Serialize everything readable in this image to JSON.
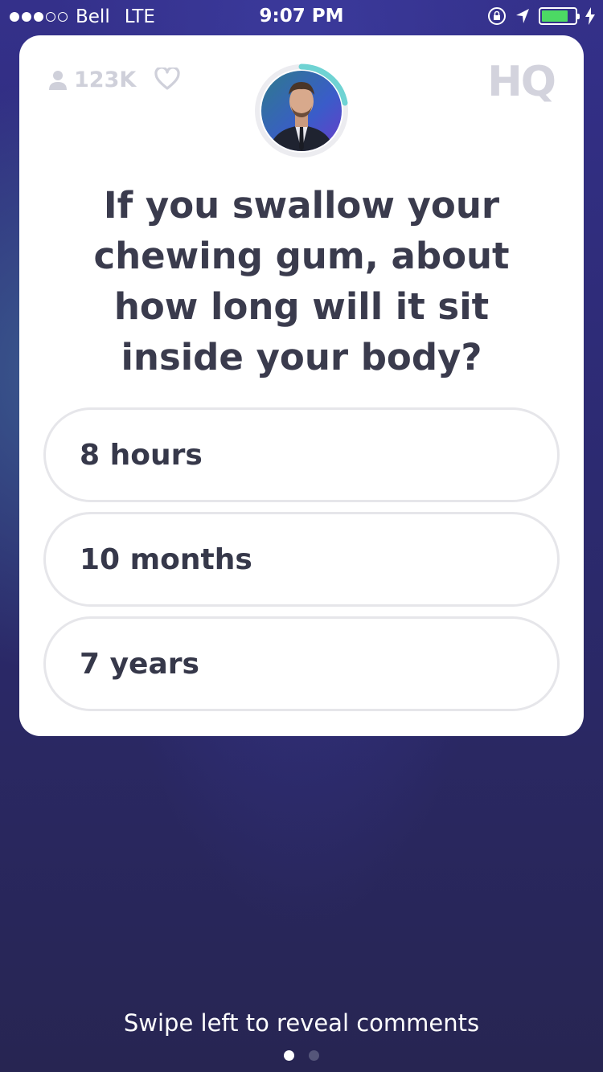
{
  "status_bar": {
    "carrier": "Bell",
    "network": "LTE",
    "time": "9:07 PM",
    "signal_bars_filled": 3,
    "signal_bars_total": 5,
    "battery_level": 0.8,
    "battery_color": "#4cd964"
  },
  "header": {
    "viewer_count": "123K",
    "logo": "HQ"
  },
  "question": {
    "text": "If you swallow your chewing gum, about how long will it sit inside your body?"
  },
  "answers": [
    {
      "label": "8 hours"
    },
    {
      "label": "10 months"
    },
    {
      "label": "7 years"
    }
  ],
  "footer": {
    "hint": "Swipe left to reveal comments",
    "page_count": 2,
    "current_page": 1
  },
  "colors": {
    "card": "#ffffff",
    "text": "#36384a",
    "timer_ring": "#6fd3d3"
  }
}
